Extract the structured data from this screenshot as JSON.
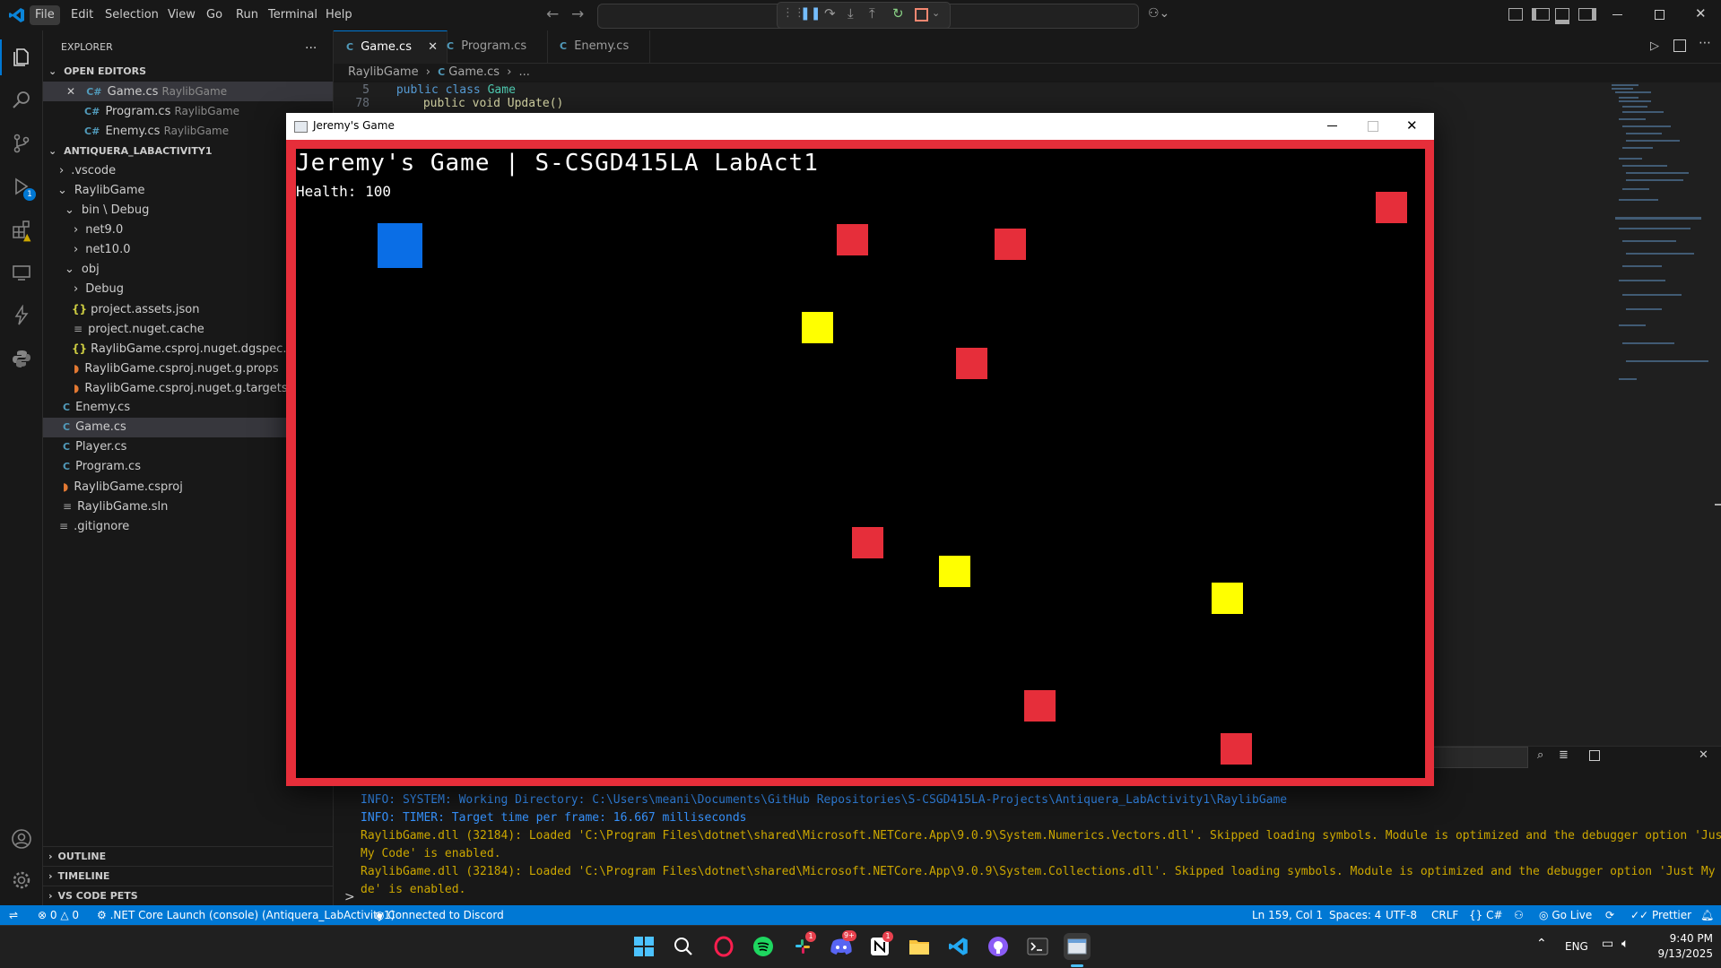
{
  "menu": [
    "File",
    "Edit",
    "Selection",
    "View",
    "Go",
    "Run",
    "Terminal",
    "Help"
  ],
  "activity_icons": [
    "explorer-icon",
    "search-icon",
    "source-control-icon",
    "run-debug-icon",
    "extensions-icon",
    "remote-explorer-icon",
    "bolt-icon",
    "python-icon"
  ],
  "activity_bottom": [
    "account-icon",
    "settings-gear-icon"
  ],
  "debug_badge": "1",
  "sidebar": {
    "title": "EXPLORER",
    "more": "...",
    "open_editors_header": "OPEN EDITORS",
    "open_editors": [
      {
        "name": "Game.cs",
        "context": "RaylibGame"
      },
      {
        "name": "Program.cs",
        "context": "RaylibGame"
      },
      {
        "name": "Enemy.cs",
        "context": "RaylibGame"
      }
    ],
    "project_header": "ANTIQUERA_LABACTIVITY1",
    "tree": [
      {
        "label": ".vscode"
      },
      {
        "label": "RaylibGame"
      },
      {
        "label": "bin \\ Debug"
      },
      {
        "label": "net9.0"
      },
      {
        "label": "net10.0"
      },
      {
        "label": "obj"
      },
      {
        "label": "Debug"
      },
      {
        "label": "project.assets.json"
      },
      {
        "label": "project.nuget.cache"
      },
      {
        "label": "RaylibGame.csproj.nuget.dgspec.json"
      },
      {
        "label": "RaylibGame.csproj.nuget.g.props"
      },
      {
        "label": "RaylibGame.csproj.nuget.g.targets"
      },
      {
        "label": "Enemy.cs"
      },
      {
        "label": "Game.cs"
      },
      {
        "label": "Player.cs"
      },
      {
        "label": "Program.cs"
      },
      {
        "label": "RaylibGame.csproj"
      },
      {
        "label": "RaylibGame.sln"
      },
      {
        "label": ".gitignore"
      }
    ],
    "bottom_sections": [
      "OUTLINE",
      "TIMELINE",
      "VS CODE PETS"
    ]
  },
  "tabs": [
    {
      "label": "Game.cs",
      "active": true
    },
    {
      "label": "Program.cs",
      "active": false
    },
    {
      "label": "Enemy.cs",
      "active": false
    }
  ],
  "breadcrumb": {
    "folder": "RaylibGame",
    "file": "Game.cs",
    "rest": "..."
  },
  "code": {
    "line_no": "5",
    "kw1": "public",
    "kw2": "class",
    "cls": "Game",
    "hidden_line_no": "78",
    "hidden_text": "public void Update()"
  },
  "output_lines": [
    {
      "text": "INFO: SYSTEM: Working Directory: C:\\Users\\meani\\Documents\\GitHub Repositories\\S-CSGD415LA-Projects\\Antiquera_LabActivity1\\RaylibGame",
      "color": "#3794ff"
    },
    {
      "text": "INFO: TIMER: Target time per frame: 16.667 milliseconds",
      "color": "#3794ff"
    },
    {
      "text": "RaylibGame.dll (32184): Loaded 'C:\\Program Files\\dotnet\\shared\\Microsoft.NETCore.App\\9.0.9\\System.Numerics.Vectors.dll'. Skipped loading symbols. Module is optimized and the debugger option 'Just",
      "color": "#cca700"
    },
    {
      "text": "My Code' is enabled.",
      "color": "#cca700"
    },
    {
      "text": "RaylibGame.dll (32184): Loaded 'C:\\Program Files\\dotnet\\shared\\Microsoft.NETCore.App\\9.0.9\\System.Collections.dll'. Skipped loading symbols. Module is optimized and the debugger option 'Just My Co",
      "color": "#cca700"
    },
    {
      "text": "de' is enabled.",
      "color": "#cca700"
    }
  ],
  "prompt_symbol": ">",
  "status": {
    "errors": "0",
    "warnings": "0",
    "launch": ".NET Core Launch (console) (Antiquera_LabActivity1)",
    "discord": "Connected to Discord",
    "position": "Ln 159, Col 1",
    "spaces": "Spaces: 4",
    "encoding": "UTF-8",
    "eol": "CRLF",
    "language": "C#",
    "golive": "Go Live",
    "prettier": "Prettier"
  },
  "game": {
    "window_title": "Jeremy's Game",
    "heading": "Jeremy's Game | S-CSGD415LA LabAct1",
    "health": "Health: 100",
    "colors": {
      "player": "#0a6ee6",
      "enemy": "#e62e3a",
      "pickup": "#ffff00",
      "border": "#e62e3a"
    }
  },
  "taskbar": {
    "lang": "ENG",
    "time": "9:40 PM",
    "date": "9/13/2025"
  }
}
